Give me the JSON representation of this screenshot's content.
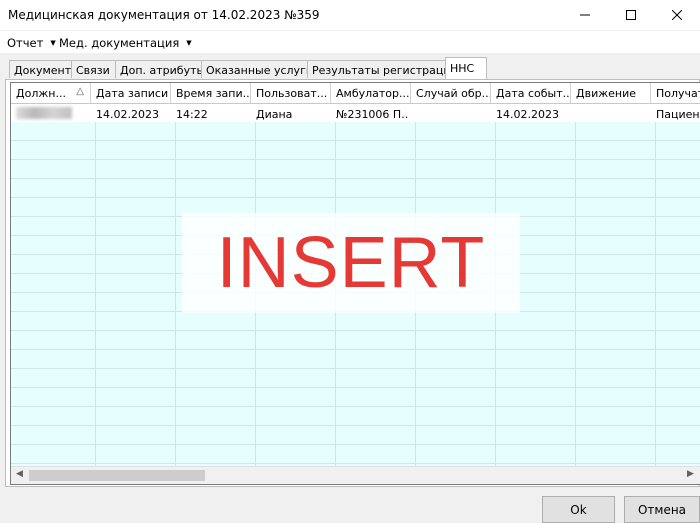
{
  "window": {
    "title": "Медицинская документация от 14.02.2023 №359"
  },
  "menu": [
    {
      "label": "Отчет"
    },
    {
      "label": "Мед. документация"
    }
  ],
  "tabs": [
    {
      "label": "Документ",
      "active": false
    },
    {
      "label": "Связи",
      "active": false
    },
    {
      "label": "Доп. атрибуты",
      "active": false
    },
    {
      "label": "Оказанные услуги",
      "active": false
    },
    {
      "label": "Результаты регистрации",
      "active": false
    },
    {
      "label": "ННС",
      "active": true
    }
  ],
  "grid": {
    "columns": [
      "Должн...",
      "Дата записи",
      "Время запи...",
      "Пользоват...",
      "Амбулатор...",
      "Случай обр...",
      "Дата событ...",
      "Движение",
      "Получат"
    ],
    "sorted_column_icon": "sort-ascending-icon",
    "rows": [
      [
        "",
        "14.02.2023",
        "14:22",
        "Диана",
        "№231006 П...",
        "",
        "14.02.2023",
        "",
        "Пациент"
      ]
    ]
  },
  "watermark": {
    "text": "INSERT"
  },
  "buttons": {
    "ok": "Ok",
    "cancel": "Отмена"
  }
}
